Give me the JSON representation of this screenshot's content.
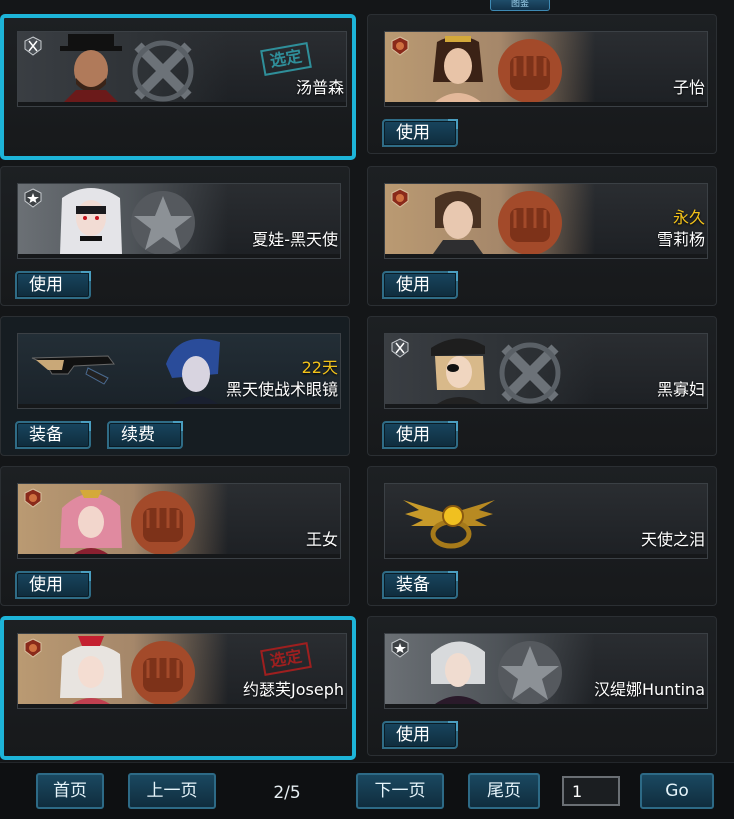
{
  "top_tab": "图鉴",
  "cards": [
    {
      "name": "汤普森",
      "duration": "",
      "stamp": "选定",
      "stamp_color": "teal",
      "buttons": [],
      "selected": true,
      "rank": "crossed-swords"
    },
    {
      "name": "子怡",
      "duration": "",
      "stamp": "",
      "buttons": [
        "使用"
      ],
      "selected": false,
      "rank": "fist"
    },
    {
      "name": "夏娃-黑天使",
      "duration": "",
      "stamp": "",
      "buttons": [
        "使用"
      ],
      "selected": false,
      "rank": "star"
    },
    {
      "name": "雪莉杨",
      "duration": "永久",
      "stamp": "",
      "buttons": [
        "使用"
      ],
      "selected": false,
      "rank": "fist"
    },
    {
      "name": "黑天使战术眼镜",
      "duration": "22天",
      "stamp": "",
      "buttons": [
        "装备",
        "续费"
      ],
      "selected": false,
      "rank": "none"
    },
    {
      "name": "黑寡妇",
      "duration": "",
      "stamp": "",
      "buttons": [
        "使用"
      ],
      "selected": false,
      "rank": "crossed-swords"
    },
    {
      "name": "王女",
      "duration": "",
      "stamp": "",
      "buttons": [
        "使用"
      ],
      "selected": false,
      "rank": "fist"
    },
    {
      "name": "天使之泪",
      "duration": "",
      "stamp": "",
      "buttons": [
        "装备"
      ],
      "selected": false,
      "rank": "none"
    },
    {
      "name": "约瑟芙Joseph",
      "duration": "",
      "stamp": "选定",
      "stamp_color": "red",
      "buttons": [],
      "selected": true,
      "rank": "fist"
    },
    {
      "name": "汉缇娜Huntina",
      "duration": "",
      "stamp": "",
      "buttons": [
        "使用"
      ],
      "selected": false,
      "rank": "star"
    }
  ],
  "pagination": {
    "first": "首页",
    "prev": "上一页",
    "page_info": "2/5",
    "next": "下一页",
    "last": "尾页",
    "page_input": "1",
    "go": "Go"
  },
  "colors": {
    "selected_border": "#1db4d8",
    "duration_text": "#f2c21a",
    "button_bg": "#18455e"
  }
}
